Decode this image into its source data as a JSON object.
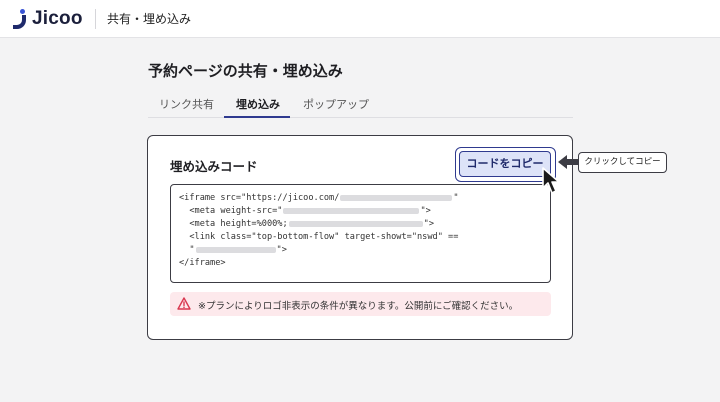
{
  "app": {
    "logo_text": "Jicoo",
    "top_title": "共有・埋め込み"
  },
  "page": {
    "title": "予約ページの共有・埋め込み"
  },
  "tabs": [
    {
      "label": "リンク共有",
      "active": false
    },
    {
      "label": "埋め込み",
      "active": true
    },
    {
      "label": "ポップアップ",
      "active": false
    }
  ],
  "card": {
    "title": "埋め込みコード",
    "copy_button": "コードをコピー",
    "code_lines": {
      "l1": "<iframe src=\"https://jicoo.com/",
      "l1_end": "\"",
      "l2": "  <meta weight-src=\"",
      "l2_end": "\">",
      "l3": "  <meta height=%000%;",
      "l3_end": "\">",
      "l4": "  <link class=\"top-bottom-flow\" target-showt=\"nswd\" ==",
      "l5": "  \"",
      "l5_end": "\">",
      "l6": "</iframe>"
    },
    "notice": "※プランによりロゴ非表示の条件が異なります。公開前にご確認ください。"
  },
  "callout": {
    "text": "クリックしてコピー"
  },
  "colors": {
    "accent": "#2f3a8f",
    "button_fill": "#dde3f8",
    "notice_bg": "#fde9ec",
    "warning": "#d9384f"
  }
}
